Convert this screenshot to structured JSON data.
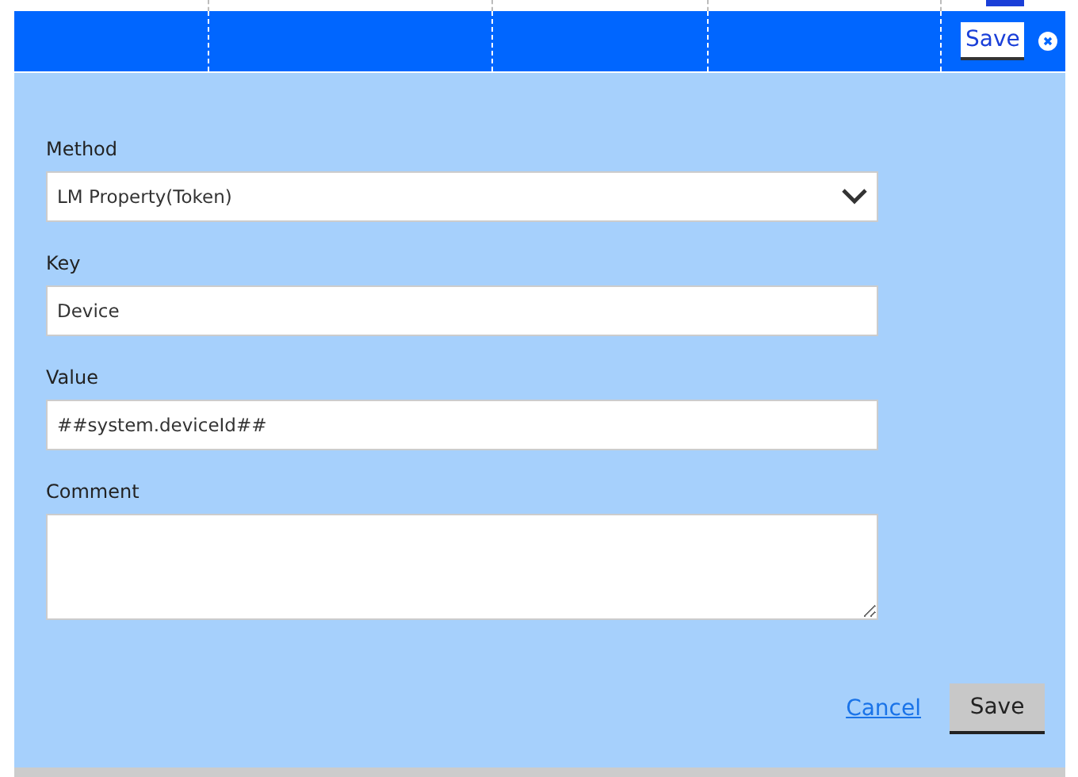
{
  "header": {
    "save_button": "Save"
  },
  "fields": [
    {
      "kind": "select",
      "label": "Method",
      "value": "LM Property(Token)"
    },
    {
      "kind": "text",
      "label": "Key",
      "value": "Device"
    },
    {
      "kind": "text",
      "label": "Value",
      "value": "##system.deviceId##"
    },
    {
      "kind": "textarea",
      "label": "Comment"
    }
  ],
  "footer": {
    "cancel": "Cancel",
    "save": "Save"
  }
}
